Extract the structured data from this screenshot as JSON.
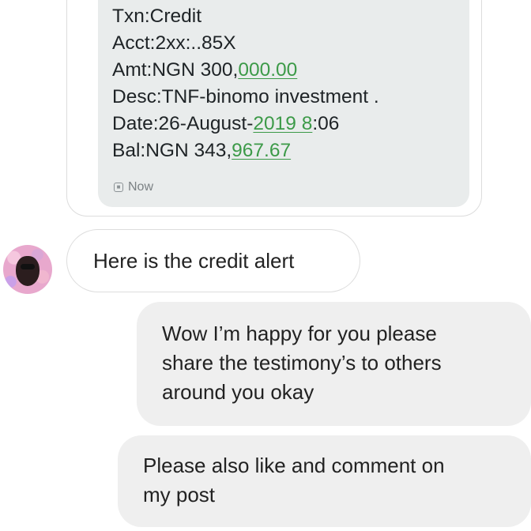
{
  "sms": {
    "lines": [
      {
        "text": "Txn:Credit"
      },
      {
        "text": "Acct:2xx:..85X"
      },
      {
        "prefix": "Amt:NGN 300,",
        "link": "000.00",
        "suffix": ""
      },
      {
        "text": "Desc:TNF-binomo investment ."
      },
      {
        "prefix": "Date:26-August-",
        "link": "2019 8",
        "suffix": ":06"
      },
      {
        "prefix": "Bal:NGN 343,",
        "link": "967.67",
        "suffix": ""
      }
    ],
    "status": "Now",
    "link_color": "#3c9a48"
  },
  "received": {
    "text": "Here is the credit alert",
    "avatar_icon": "profile-avatar"
  },
  "sent": [
    {
      "lines": [
        "Wow I’m happy for you please",
        "share the testimony’s to others",
        "around you okay"
      ]
    },
    {
      "lines": [
        "Please also like and comment on",
        "my post"
      ]
    }
  ]
}
